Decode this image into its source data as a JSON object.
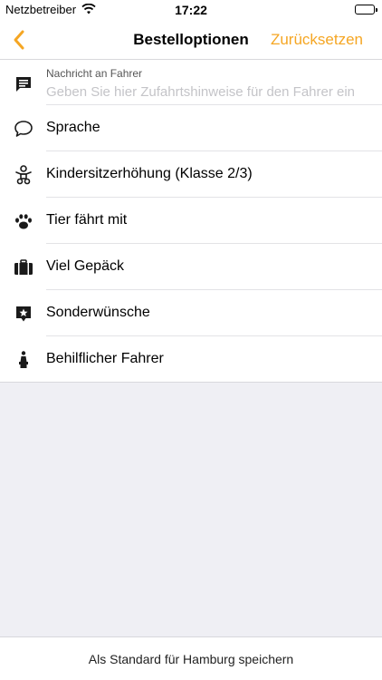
{
  "status_bar": {
    "carrier": "Netzbetreiber",
    "time": "17:22",
    "wifi_icon": "wifi-icon",
    "battery_icon": "battery-icon"
  },
  "nav": {
    "back_icon": "chevron-left-icon",
    "title": "Bestelloptionen",
    "reset_label": "Zurücksetzen"
  },
  "message": {
    "caption": "Nachricht an Fahrer",
    "placeholder": "Geben Sie hier Zufahrtshinweise für den Fahrer ein",
    "value": "",
    "icon": "message-icon"
  },
  "options": [
    {
      "label": "Sprache",
      "icon": "speech-bubble-icon"
    },
    {
      "label": "Kindersitzerhöhung (Klasse 2/3)",
      "icon": "child-seat-icon"
    },
    {
      "label": "Tier fährt mit",
      "icon": "paw-icon"
    },
    {
      "label": "Viel Gepäck",
      "icon": "luggage-icon"
    },
    {
      "label": "Sonderwünsche",
      "icon": "star-bubble-icon"
    },
    {
      "label": "Behilflicher Fahrer",
      "icon": "driver-icon"
    }
  ],
  "footer": {
    "save_label": "Als Standard für Hamburg speichern"
  },
  "colors": {
    "accent": "#f5a623",
    "background": "#efeff4",
    "surface": "#ffffff"
  }
}
